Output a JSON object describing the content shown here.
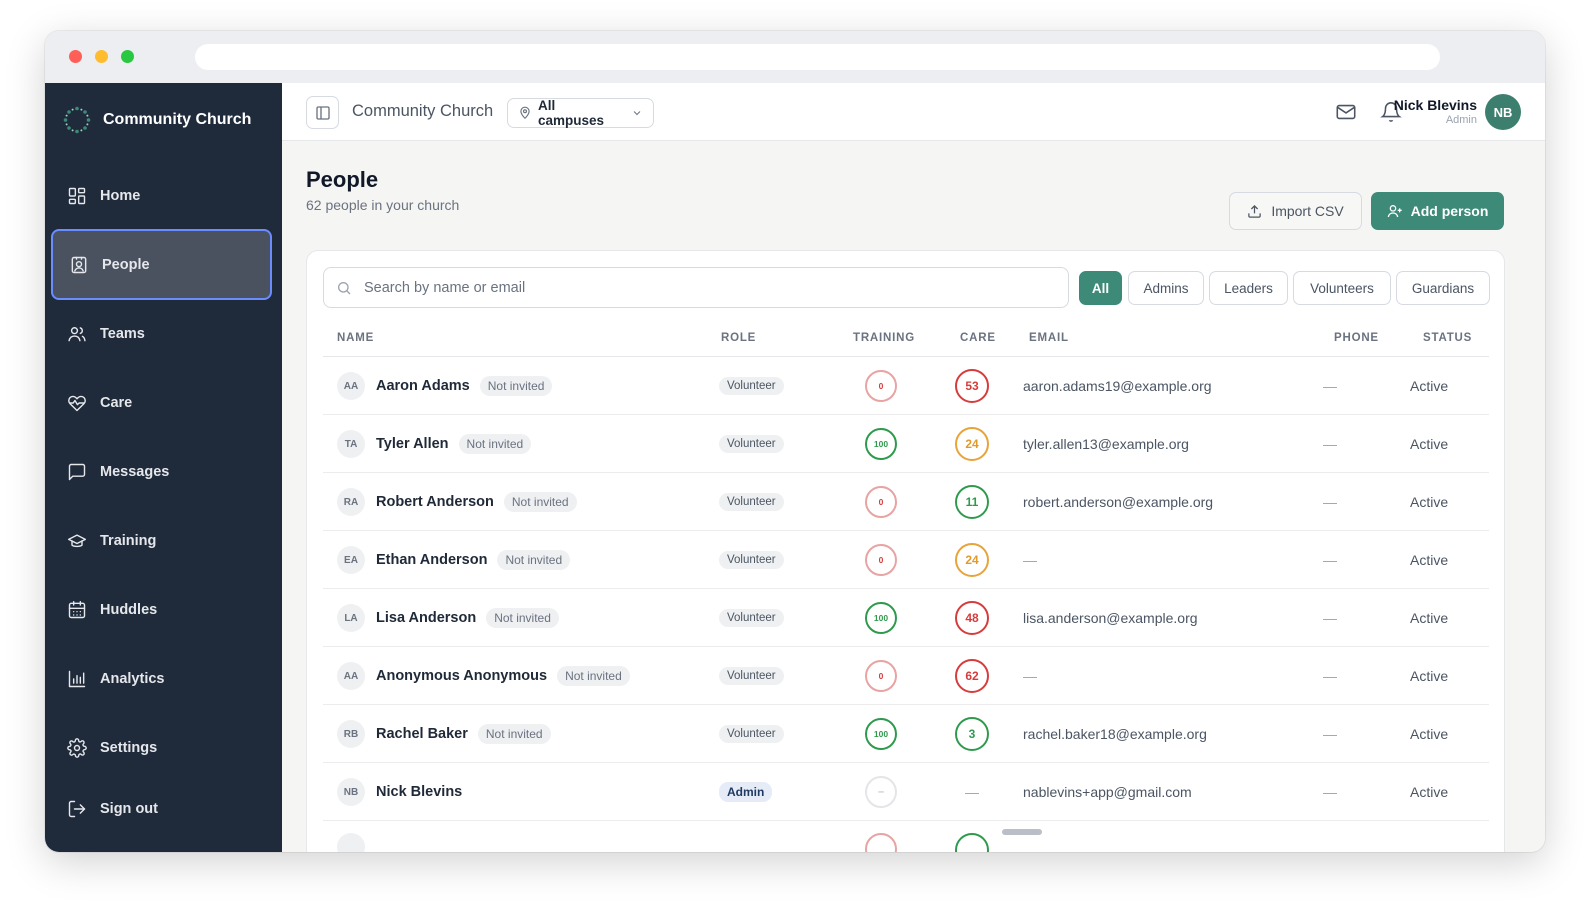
{
  "app": {
    "brand": "Community Church",
    "nav": [
      {
        "key": "home",
        "label": "Home",
        "icon": "grid-icon"
      },
      {
        "key": "people",
        "label": "People",
        "icon": "contact-card-icon"
      },
      {
        "key": "teams",
        "label": "Teams",
        "icon": "users-icon"
      },
      {
        "key": "care",
        "label": "Care",
        "icon": "heart-pulse-icon"
      },
      {
        "key": "messages",
        "label": "Messages",
        "icon": "chat-icon"
      },
      {
        "key": "training",
        "label": "Training",
        "icon": "graduation-cap-icon"
      },
      {
        "key": "huddles",
        "label": "Huddles",
        "icon": "calendar-icon"
      },
      {
        "key": "analytics",
        "label": "Analytics",
        "icon": "bar-chart-icon"
      },
      {
        "key": "settings",
        "label": "Settings",
        "icon": "gear-icon"
      },
      {
        "key": "signout",
        "label": "Sign out",
        "icon": "sign-out-icon"
      }
    ],
    "active_nav": "people"
  },
  "topbar": {
    "title": "Community Church",
    "campus": "All campuses",
    "user_name": "Nick Blevins",
    "user_role": "Admin",
    "user_initials": "NB"
  },
  "page": {
    "title": "People",
    "subtitle": "62 people in your church",
    "import_label": "Import CSV",
    "add_label": "Add person"
  },
  "search": {
    "placeholder": "Search by name or email",
    "value": ""
  },
  "filters": [
    "All",
    "Admins",
    "Leaders",
    "Volunteers",
    "Guardians"
  ],
  "active_filter": "All",
  "colors": {
    "accent": "#3d8a78",
    "sidebar": "#1f2a3a",
    "danger": "#d63c3c",
    "success": "#2f9a4e",
    "warning": "#e8a33a"
  },
  "table": {
    "headers": {
      "name": "NAME",
      "role": "ROLE",
      "training": "TRAINING",
      "care": "CARE",
      "email": "EMAIL",
      "phone": "PHONE",
      "status": "STATUS"
    },
    "rows": [
      {
        "initials": "AA",
        "name": "Aaron Adams",
        "invite": "Not invited",
        "role": "Volunteer",
        "training": "0",
        "training_tone": "pinkred",
        "care": "53",
        "care_tone": "red",
        "email": "aaron.adams19@example.org",
        "phone": "—",
        "status": "Active"
      },
      {
        "initials": "TA",
        "name": "Tyler Allen",
        "invite": "Not invited",
        "role": "Volunteer",
        "training": "100",
        "training_tone": "green",
        "care": "24",
        "care_tone": "orange",
        "email": "tyler.allen13@example.org",
        "phone": "—",
        "status": "Active"
      },
      {
        "initials": "RA",
        "name": "Robert Anderson",
        "invite": "Not invited",
        "role": "Volunteer",
        "training": "0",
        "training_tone": "pinkred",
        "care": "11",
        "care_tone": "green",
        "email": "robert.anderson@example.org",
        "phone": "—",
        "status": "Active"
      },
      {
        "initials": "EA",
        "name": "Ethan Anderson",
        "invite": "Not invited",
        "role": "Volunteer",
        "training": "0",
        "training_tone": "pinkred",
        "care": "24",
        "care_tone": "orange",
        "email": "—",
        "phone": "—",
        "status": "Active"
      },
      {
        "initials": "LA",
        "name": "Lisa Anderson",
        "invite": "Not invited",
        "role": "Volunteer",
        "training": "100",
        "training_tone": "green",
        "care": "48",
        "care_tone": "red",
        "email": "lisa.anderson@example.org",
        "phone": "—",
        "status": "Active"
      },
      {
        "initials": "AA",
        "name": "Anonymous Anonymous",
        "invite": "Not invited",
        "role": "Volunteer",
        "training": "0",
        "training_tone": "pinkred",
        "care": "62",
        "care_tone": "red",
        "email": "—",
        "phone": "—",
        "status": "Active"
      },
      {
        "initials": "RB",
        "name": "Rachel Baker",
        "invite": "Not invited",
        "role": "Volunteer",
        "training": "100",
        "training_tone": "green",
        "care": "3",
        "care_tone": "green",
        "email": "rachel.baker18@example.org",
        "phone": "—",
        "status": "Active"
      },
      {
        "initials": "NB",
        "name": "Nick Blevins",
        "invite": "",
        "role": "Admin",
        "training": "–",
        "training_tone": "muted",
        "care": "—",
        "care_tone": "none",
        "email": "nablevins+app@gmail.com",
        "phone": "—",
        "status": "Active"
      }
    ]
  }
}
